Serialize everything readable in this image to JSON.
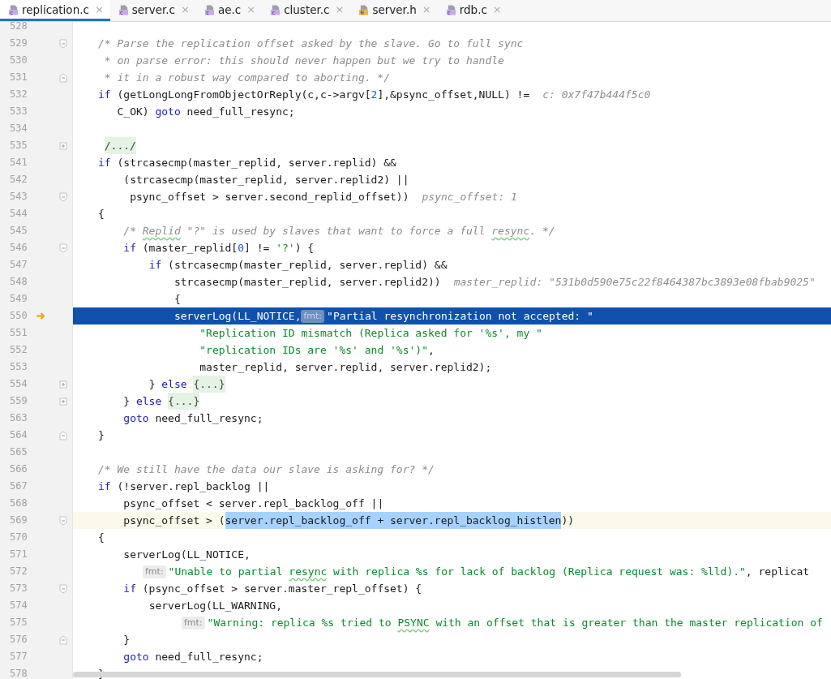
{
  "tabs": [
    {
      "label": "replication.c",
      "badge": "c",
      "kind": "source",
      "close": "×",
      "selected": true
    },
    {
      "label": "server.c",
      "badge": "c",
      "kind": "source",
      "close": "×",
      "selected": false
    },
    {
      "label": "ae.c",
      "badge": "c",
      "kind": "source",
      "close": "×",
      "selected": false
    },
    {
      "label": "cluster.c",
      "badge": "c",
      "kind": "source",
      "close": "×",
      "selected": false
    },
    {
      "label": "server.h",
      "badge": "H",
      "kind": "header",
      "close": "×",
      "selected": false
    },
    {
      "label": "rdb.c",
      "badge": "c",
      "kind": "source",
      "close": "×",
      "selected": false
    }
  ],
  "lines": [
    {
      "number": "528"
    },
    {
      "number": "529",
      "fold_marker": {
        "kind": "start"
      },
      "tokens": [
        {
          "kind": "comment",
          "text": "/* Parse the replication offset asked by the slave. Go to full sync"
        }
      ]
    },
    {
      "number": "530",
      "tokens": [
        {
          "kind": "comment",
          "text": " * on parse error: this should never happen but we try to handle"
        }
      ]
    },
    {
      "number": "531",
      "fold_marker": {
        "kind": "end"
      },
      "tokens": [
        {
          "kind": "comment",
          "text": " * it in a robust way compared to aborting. */"
        }
      ]
    },
    {
      "number": "532",
      "tokens": [
        {
          "kind": "keyword",
          "text": "if"
        },
        {
          "kind": "plain",
          "text": " (getLongLongFromObjectOrReply(c,c->argv["
        },
        {
          "kind": "number",
          "text": "2"
        },
        {
          "kind": "plain",
          "text": "],&psync_offset,NULL) !="
        },
        {
          "kind": "hint",
          "text": "c: 0x7f47b444f5c0"
        }
      ]
    },
    {
      "number": "533",
      "tokens": [
        {
          "kind": "plain",
          "text": "   C_OK) "
        },
        {
          "kind": "keyword",
          "text": "goto"
        },
        {
          "kind": "plain",
          "text": " need_full_resync;"
        }
      ]
    },
    {
      "number": "534"
    },
    {
      "number": "535",
      "fold_marker": {
        "kind": "collapsed"
      },
      "tokens": [
        {
          "kind": "folded",
          "text": "/.../"
        }
      ]
    },
    {
      "number": "541",
      "tokens": [
        {
          "kind": "keyword",
          "text": "if"
        },
        {
          "kind": "plain",
          "text": " (strcasecmp(master_replid, server.replid) &&"
        }
      ]
    },
    {
      "number": "542",
      "tokens": [
        {
          "kind": "plain",
          "text": "    (strcasecmp(master_replid, server.replid2) ||"
        }
      ]
    },
    {
      "number": "543",
      "fold_marker": {
        "kind": "start"
      },
      "tokens": [
        {
          "kind": "plain",
          "text": "     psync_offset > server.second_replid_offset))"
        },
        {
          "kind": "hint",
          "text": "psync_offset: 1"
        }
      ]
    },
    {
      "number": "544",
      "tokens": [
        {
          "kind": "plain",
          "text": "{"
        }
      ]
    },
    {
      "number": "545",
      "tokens": [
        {
          "kind": "comment",
          "text": "    /* "
        },
        {
          "kind": "comment",
          "text": "Replid",
          "typo": true
        },
        {
          "kind": "comment",
          "text": " \"?\" is used by slaves that want to force a full "
        },
        {
          "kind": "comment",
          "text": "resync",
          "typo": true
        },
        {
          "kind": "comment",
          "text": ". */"
        }
      ]
    },
    {
      "number": "546",
      "fold_marker": {
        "kind": "start"
      },
      "tokens": [
        {
          "kind": "keyword",
          "text": "    if"
        },
        {
          "kind": "plain",
          "text": " (master_replid["
        },
        {
          "kind": "number",
          "text": "0"
        },
        {
          "kind": "plain",
          "text": "] != "
        },
        {
          "kind": "string",
          "text": "'?'"
        },
        {
          "kind": "plain",
          "text": ") {"
        }
      ]
    },
    {
      "number": "547",
      "tokens": [
        {
          "kind": "keyword",
          "text": "        if"
        },
        {
          "kind": "plain",
          "text": " (strcasecmp(master_replid, server.replid) &&"
        }
      ]
    },
    {
      "number": "548",
      "tokens": [
        {
          "kind": "plain",
          "text": "            strcasecmp(master_replid, server.replid2))"
        },
        {
          "kind": "hint",
          "text": "master_replid: \"531b0d590e75c22f8464387bc3893e08fbab9025\""
        }
      ]
    },
    {
      "number": "549",
      "tokens": [
        {
          "kind": "plain",
          "text": "            {"
        }
      ]
    },
    {
      "number": "550",
      "execution": true,
      "tokens": [
        {
          "kind": "plain",
          "text": "            serverLog(LL_NOTICE,"
        },
        {
          "kind": "param",
          "text": "fmt:"
        },
        {
          "kind": "string",
          "text": "\"Partial resynchronization not accepted: \""
        }
      ]
    },
    {
      "number": "551",
      "tokens": [
        {
          "kind": "string",
          "text": "                \"Replication ID mismatch (Replica asked for '%s', my \""
        }
      ]
    },
    {
      "number": "552",
      "tokens": [
        {
          "kind": "string",
          "text": "                \"replication IDs are '%s' and '%s')\""
        },
        {
          "kind": "plain",
          "text": ","
        }
      ]
    },
    {
      "number": "553",
      "tokens": [
        {
          "kind": "plain",
          "text": "                master_replid, server.replid, server.replid2);"
        }
      ]
    },
    {
      "number": "554",
      "fold_marker": {
        "kind": "collapsed"
      },
      "tokens": [
        {
          "kind": "plain",
          "text": "        } "
        },
        {
          "kind": "keyword",
          "text": "else"
        },
        {
          "kind": "folded",
          "text": "{...}"
        }
      ]
    },
    {
      "number": "559",
      "fold_marker": {
        "kind": "collapsed"
      },
      "tokens": [
        {
          "kind": "plain",
          "text": "    } "
        },
        {
          "kind": "keyword",
          "text": "else"
        },
        {
          "kind": "folded",
          "text": "{...}"
        }
      ]
    },
    {
      "number": "563",
      "tokens": [
        {
          "kind": "keyword",
          "text": "    goto"
        },
        {
          "kind": "plain",
          "text": " need_full_resync;"
        }
      ]
    },
    {
      "number": "564",
      "fold_marker": {
        "kind": "end"
      },
      "tokens": [
        {
          "kind": "plain",
          "text": "}"
        }
      ]
    },
    {
      "number": "565"
    },
    {
      "number": "566",
      "tokens": [
        {
          "kind": "comment",
          "text": "/* We still have the data our slave is asking for? */"
        }
      ]
    },
    {
      "number": "567",
      "tokens": [
        {
          "kind": "keyword",
          "text": "if"
        },
        {
          "kind": "plain",
          "text": " (!server.repl_backlog ||"
        }
      ]
    },
    {
      "number": "568",
      "tokens": [
        {
          "kind": "plain",
          "text": "    psync_offset < server.repl_backlog_off ||"
        }
      ]
    },
    {
      "number": "569",
      "fold_marker": {
        "kind": "start"
      },
      "current": true,
      "tokens": [
        {
          "kind": "plain",
          "text": "    psync_offset > ("
        },
        {
          "kind": "selection",
          "text": "server.repl_backlog_off + server.repl_backlog_histlen"
        },
        {
          "kind": "plain",
          "text": "))"
        }
      ]
    },
    {
      "number": "570",
      "tokens": [
        {
          "kind": "plain",
          "text": "{"
        }
      ]
    },
    {
      "number": "571",
      "tokens": [
        {
          "kind": "plain",
          "text": "    serverLog(LL_NOTICE,"
        }
      ]
    },
    {
      "number": "572",
      "tokens": [
        {
          "kind": "param",
          "text": "fmt:"
        },
        {
          "kind": "string",
          "text": "\"Unable to partial "
        },
        {
          "kind": "string",
          "text": "resync",
          "typo": true
        },
        {
          "kind": "string",
          "text": " with replica %s for lack of backlog (Replica request was: %lld).\""
        },
        {
          "kind": "plain",
          "text": ", replicat"
        }
      ]
    },
    {
      "number": "573",
      "fold_marker": {
        "kind": "start"
      },
      "tokens": [
        {
          "kind": "keyword",
          "text": "    if"
        },
        {
          "kind": "plain",
          "text": " (psync_offset > server.master_repl_offset) {"
        }
      ]
    },
    {
      "number": "574",
      "tokens": [
        {
          "kind": "plain",
          "text": "        serverLog(LL_WARNING,"
        }
      ]
    },
    {
      "number": "575",
      "tokens": [
        {
          "kind": "param",
          "text": "fmt:"
        },
        {
          "kind": "string",
          "text": "\"Warning: replica %s tried to "
        },
        {
          "kind": "string",
          "text": "PSYNC",
          "typo": true
        },
        {
          "kind": "string",
          "text": " with an offset that is greater than the master replication of"
        }
      ]
    },
    {
      "number": "576",
      "fold_marker": {
        "kind": "end"
      },
      "tokens": [
        {
          "kind": "plain",
          "text": "    }"
        }
      ]
    },
    {
      "number": "577",
      "tokens": [
        {
          "kind": "keyword",
          "text": "    goto"
        },
        {
          "kind": "plain",
          "text": " need_full_resync;"
        }
      ]
    },
    {
      "number": "578",
      "tokens": [
        {
          "kind": "plain",
          "text": "}"
        }
      ]
    }
  ]
}
